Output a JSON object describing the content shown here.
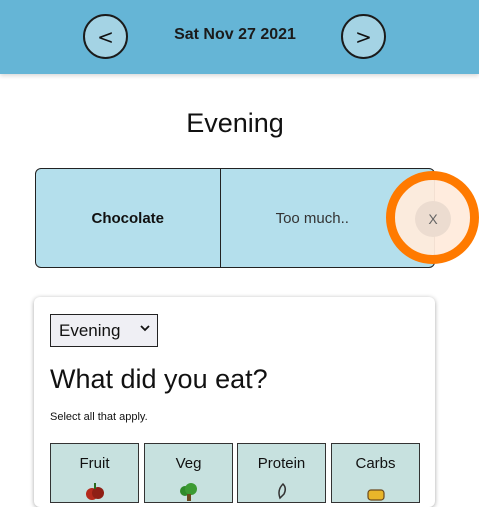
{
  "header": {
    "prev_label": "<",
    "next_label": ">",
    "date": "Sat Nov 27 2021"
  },
  "period_title": "Evening",
  "entry": {
    "food": "Chocolate",
    "note": "Too much..",
    "delete_label": "X"
  },
  "form": {
    "meal_select": "Evening",
    "question": "What did you eat?",
    "hint": "Select all that apply.",
    "categories": [
      {
        "label": "Fruit",
        "icon": "fruit-icon"
      },
      {
        "label": "Veg",
        "icon": "vegetable-icon"
      },
      {
        "label": "Protein",
        "icon": "protein-icon"
      },
      {
        "label": "Carbs",
        "icon": "carbs-icon"
      }
    ]
  },
  "colors": {
    "header_bg": "#65b5d6",
    "entry_bg": "#b4dfec",
    "highlight_ring": "#ff7a00",
    "category_bg": "#c7e1df"
  }
}
